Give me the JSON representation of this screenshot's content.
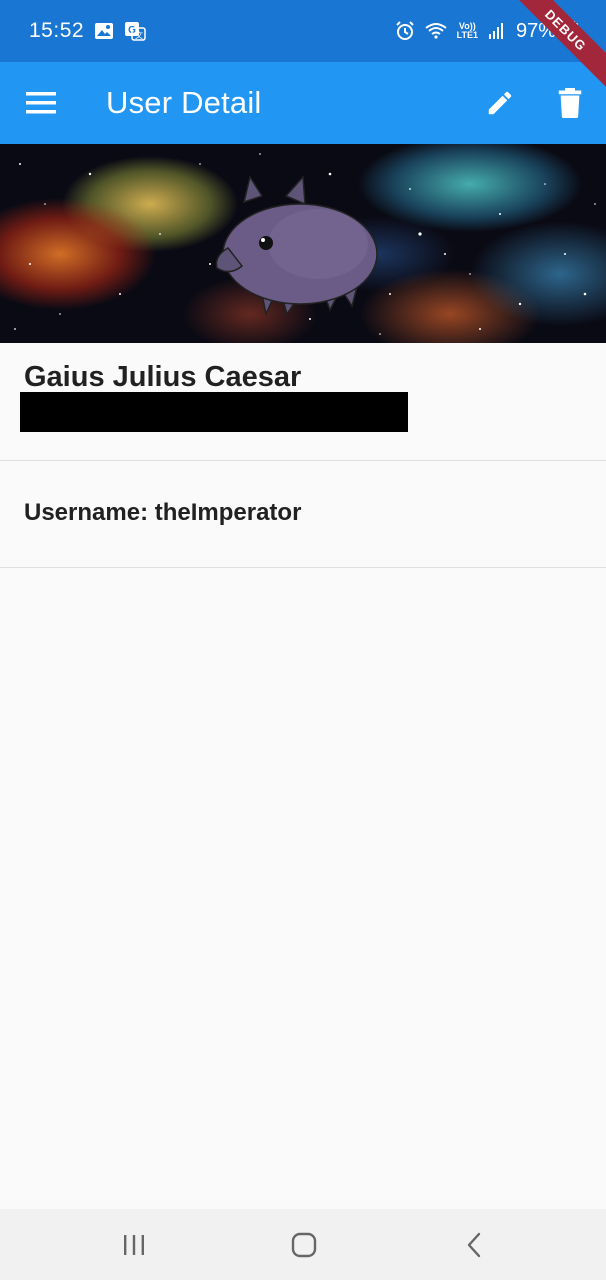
{
  "status_bar": {
    "time": "15:52",
    "battery": "97%",
    "left_icons": [
      "gallery-icon",
      "translate-icon"
    ],
    "right_icons": [
      "alarm-icon",
      "wifi-icon",
      "volte-icon",
      "signal-icon",
      "battery-icon"
    ],
    "volte_text": "Vo))",
    "lte_text": "LTE1"
  },
  "debug_ribbon": {
    "label": "DEBUG"
  },
  "app_bar": {
    "title": "User Detail",
    "menu_icon": "menu-icon",
    "edit_icon": "edit-icon",
    "delete_icon": "delete-icon"
  },
  "banner": {
    "description_icon": "pig-avatar"
  },
  "user": {
    "name": "Gaius Julius Caesar",
    "username_line": "Username: theImperator"
  },
  "nav_bar": {
    "icons": [
      "recents-icon",
      "home-icon",
      "back-icon"
    ]
  },
  "colors": {
    "status_bar": "#1976d2",
    "app_bar": "#2196f3",
    "debug_ribbon": "#a3273a",
    "background": "#fafafa",
    "nav_bar": "#f1f1f1"
  }
}
